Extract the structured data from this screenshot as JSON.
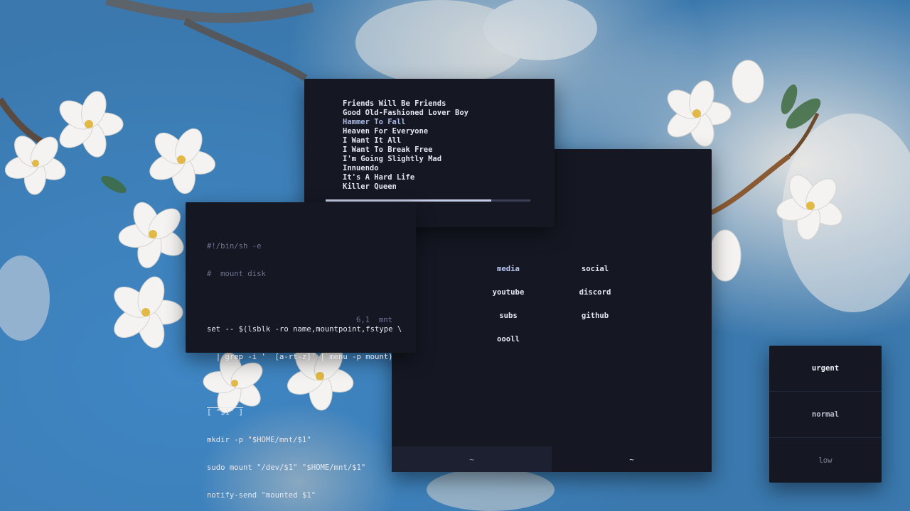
{
  "music_player": {
    "tracks": [
      {
        "title": "Friends Will Be Friends",
        "active": false
      },
      {
        "title": "Good Old-Fashioned Lover Boy",
        "active": false
      },
      {
        "title": "Hammer To Fall",
        "active": true
      },
      {
        "title": "Heaven For Everyone",
        "active": false
      },
      {
        "title": "I Want It All",
        "active": false
      },
      {
        "title": "I Want To Break Free",
        "active": false
      },
      {
        "title": "I'm Going Slightly Mad",
        "active": false
      },
      {
        "title": "Innuendo",
        "active": false
      },
      {
        "title": "It's A Hard Life",
        "active": false
      },
      {
        "title": "Killer Queen",
        "active": false
      }
    ],
    "progress_fraction": 0.81
  },
  "editor": {
    "lines": [
      {
        "text": "#!/bin/sh -e",
        "type": "comment"
      },
      {
        "text": "#  mount disk",
        "type": "comment"
      },
      {
        "text": "",
        "type": "code"
      },
      {
        "text": "set -- $(lsblk -ro name,mountpoint,fstype \\",
        "type": "code"
      },
      {
        "text": "  | grep -i '  [a-rt-z]' | menu -p mount)",
        "type": "code"
      },
      {
        "text": "",
        "type": "code"
      },
      {
        "text": "[ \"$1\" ]",
        "type": "code"
      },
      {
        "text": "mkdir -p \"$HOME/mnt/$1\"",
        "type": "code"
      },
      {
        "text": "sudo mount \"/dev/$1\" \"$HOME/mnt/$1\"",
        "type": "code"
      },
      {
        "text": "notify-send \"mounted $1\"",
        "type": "code"
      }
    ],
    "statusline": "6,1  mnt"
  },
  "file_manager": {
    "directories": [
      "media",
      "social",
      "youtube",
      "discord",
      "subs",
      "github",
      "oooll"
    ],
    "tabs": [
      {
        "label": "~",
        "active": true
      },
      {
        "label": "~",
        "active": false
      }
    ]
  },
  "notifications": {
    "items": [
      {
        "label": "urgent",
        "level": "urgent"
      },
      {
        "label": "normal",
        "level": "normal"
      },
      {
        "label": "low",
        "level": "low"
      }
    ]
  },
  "colors": {
    "window_bg": "#151823",
    "accent": "#a9b9e3",
    "text": "#e1e4ee",
    "comment": "#6c7391"
  }
}
